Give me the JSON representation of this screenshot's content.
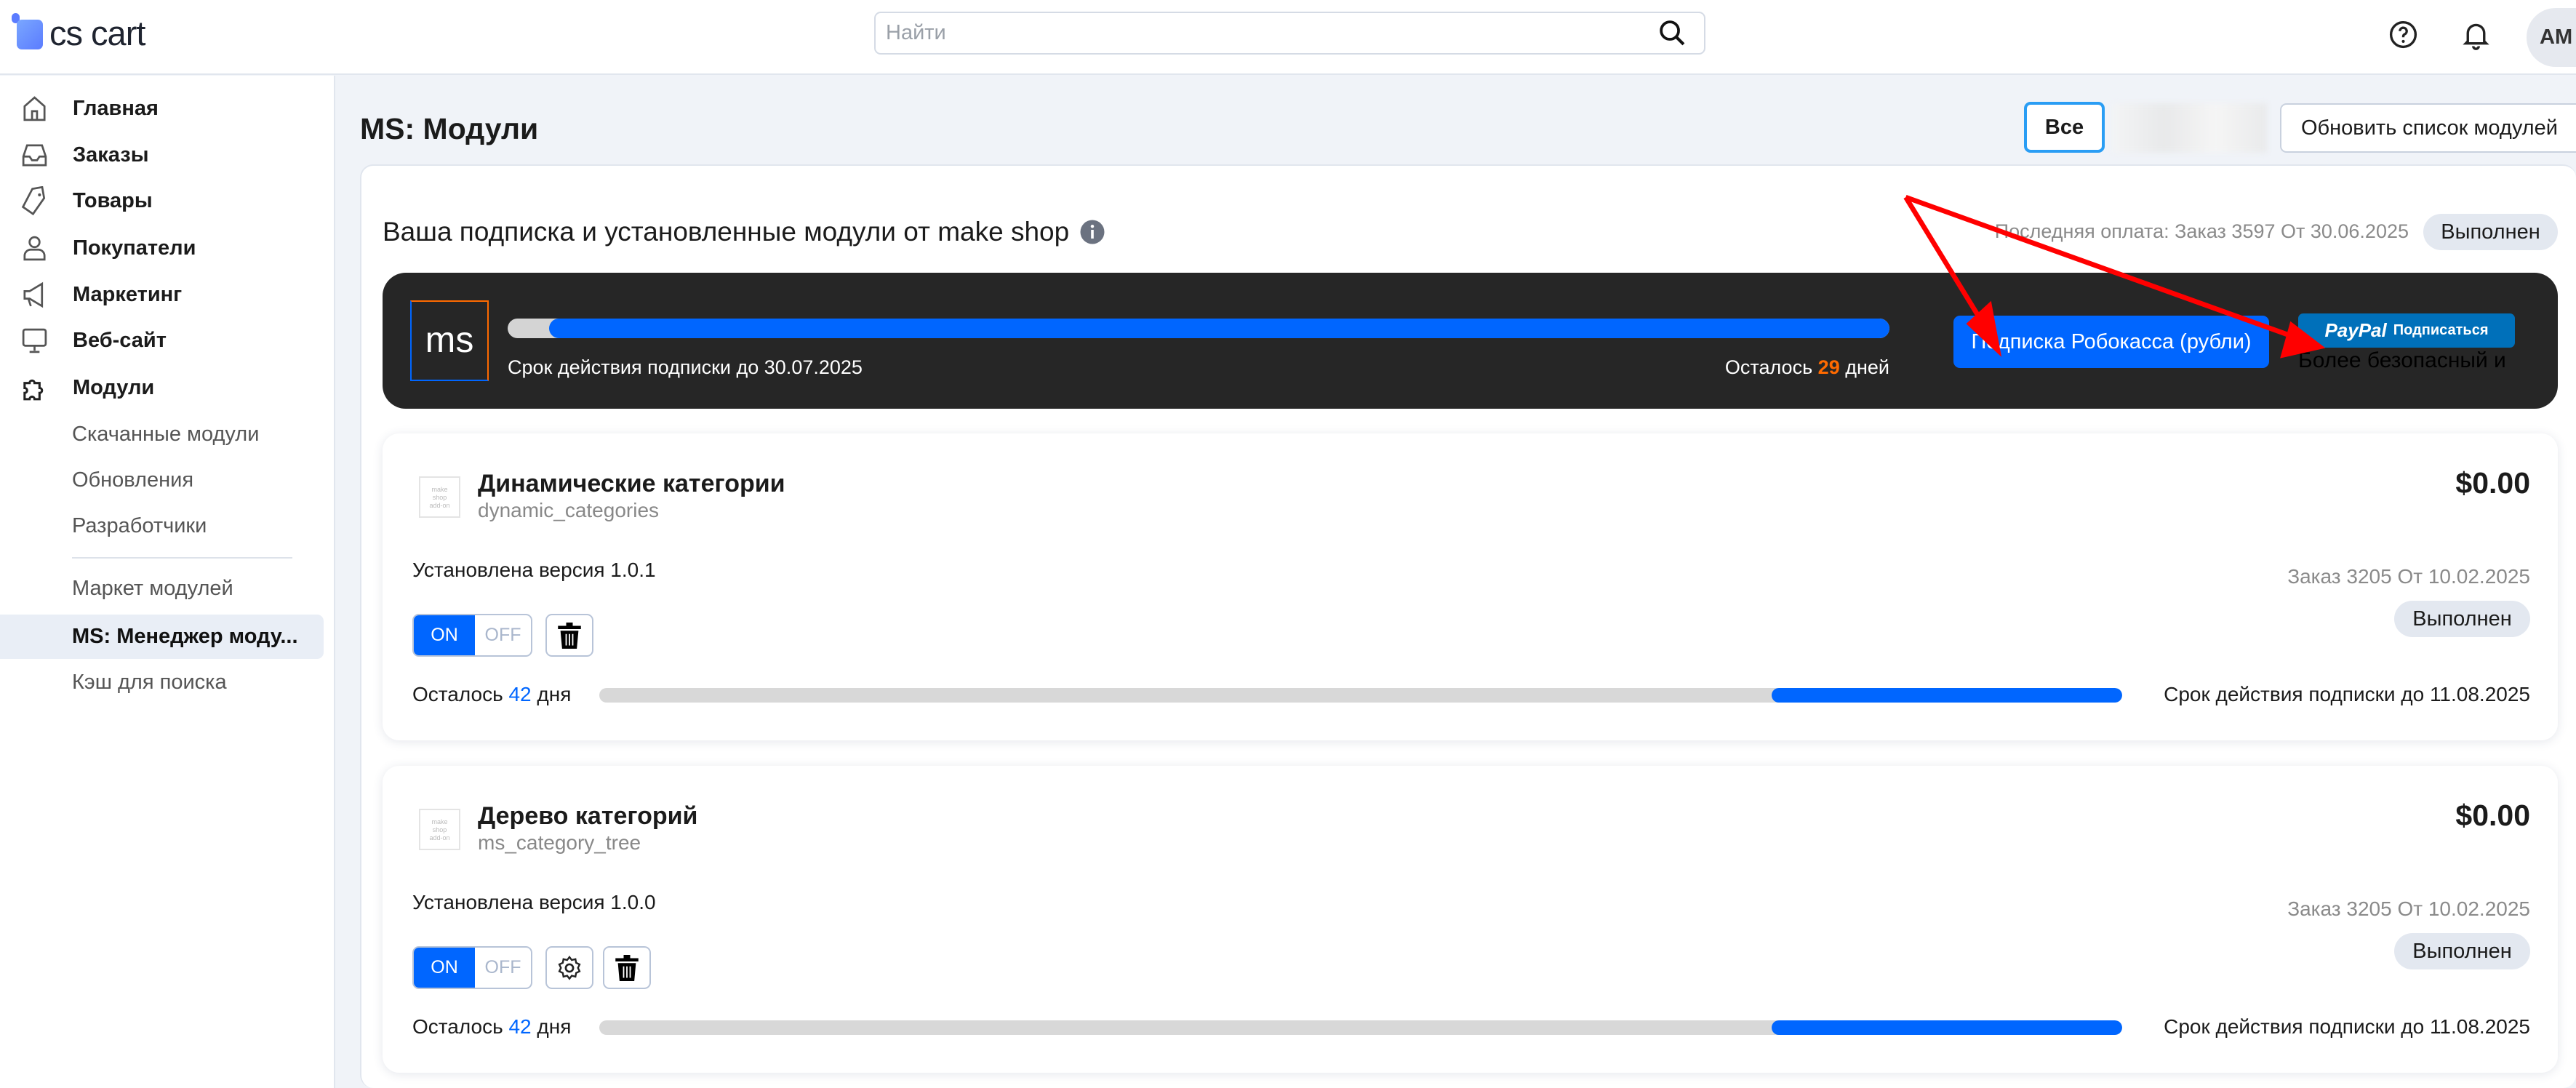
{
  "header": {
    "logo_text": "cs cart",
    "search_placeholder": "Найти",
    "avatar_initials": "AM"
  },
  "sidebar": {
    "items": [
      {
        "label": "Главная",
        "icon": "home-icon"
      },
      {
        "label": "Заказы",
        "icon": "inbox-icon"
      },
      {
        "label": "Товары",
        "icon": "tag-icon"
      },
      {
        "label": "Покупатели",
        "icon": "user-icon"
      },
      {
        "label": "Маркетинг",
        "icon": "megaphone-icon"
      },
      {
        "label": "Веб-сайт",
        "icon": "monitor-icon"
      },
      {
        "label": "Модули",
        "icon": "puzzle-icon"
      }
    ],
    "subitems": [
      "Скачанные модули",
      "Обновления",
      "Разработчики",
      "Маркет модулей",
      "MS: Менеджер моду...",
      "Кэш для поиска"
    ]
  },
  "page": {
    "title": "MS: Модули",
    "filter_all": "Все",
    "refresh_label": "Обновить список модулей"
  },
  "subscription": {
    "heading": "Ваша подписка и установленные модули от make shop",
    "last_payment": "Последняя оплата: Заказ 3597 От 30.06.2025",
    "last_status": "Выполнен",
    "logo": "ms",
    "progress_fraction": 0.97,
    "valid_until": "Срок действия подписки до 30.07.2025",
    "remaining_prefix": "Осталось",
    "remaining_days": "29",
    "remaining_suffix": "дней",
    "robokassa_label": "Подписка Робокасса (рубли)",
    "paypal_brand": "PayPal",
    "paypal_label": "Подписаться",
    "paypal_note": "Более безопасный и",
    "accent": "#0066ff",
    "days_color": "#ff6a00"
  },
  "modules": [
    {
      "name": "Динамические категории",
      "slug": "dynamic_categories",
      "price": "$0.00",
      "version": "Установлена версия 1.0.1",
      "order": "Заказ 3205 От 10.02.2025",
      "status": "Выполнен",
      "on": "ON",
      "off": "OFF",
      "has_settings": false,
      "remaining_prefix": "Осталось",
      "remaining_days": "42",
      "remaining_suffix": "дня",
      "progress_fraction": 0.23,
      "valid_until": "Срок действия подписки до 11.08.2025",
      "placeholder": "make shop add-on"
    },
    {
      "name": "Дерево категорий",
      "slug": "ms_category_tree",
      "price": "$0.00",
      "version": "Установлена версия 1.0.0",
      "order": "Заказ 3205 От 10.02.2025",
      "status": "Выполнен",
      "on": "ON",
      "off": "OFF",
      "has_settings": true,
      "remaining_prefix": "Осталось",
      "remaining_days": "42",
      "remaining_suffix": "дня",
      "progress_fraction": 0.23,
      "valid_until": "Срок действия подписки до 11.08.2025",
      "placeholder": "make shop add-on"
    }
  ]
}
